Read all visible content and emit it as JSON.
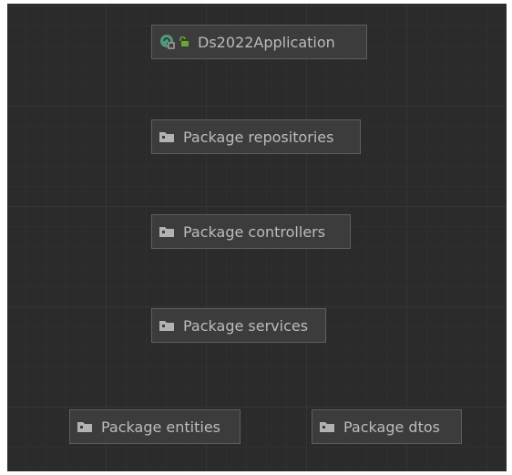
{
  "diagram": {
    "application": {
      "label": "Ds2022Application",
      "icons": [
        "spring-class-icon",
        "unlocked-padlock-icon"
      ]
    },
    "packages": [
      {
        "label": "Package repositories",
        "icon": "folder-icon"
      },
      {
        "label": "Package controllers",
        "icon": "folder-icon"
      },
      {
        "label": "Package services",
        "icon": "folder-icon"
      },
      {
        "label": "Package entities",
        "icon": "folder-icon"
      },
      {
        "label": "Package dtos",
        "icon": "folder-icon"
      }
    ]
  },
  "colors": {
    "canvas_background": "#2b2b2b",
    "node_background": "#3c3c3c",
    "node_border": "#5e5e5e",
    "text": "#bcbcbc",
    "folder_icon": "#b2b2b2",
    "spring_icon": "#4e9b7a",
    "padlock_icon": "#6aa832"
  }
}
